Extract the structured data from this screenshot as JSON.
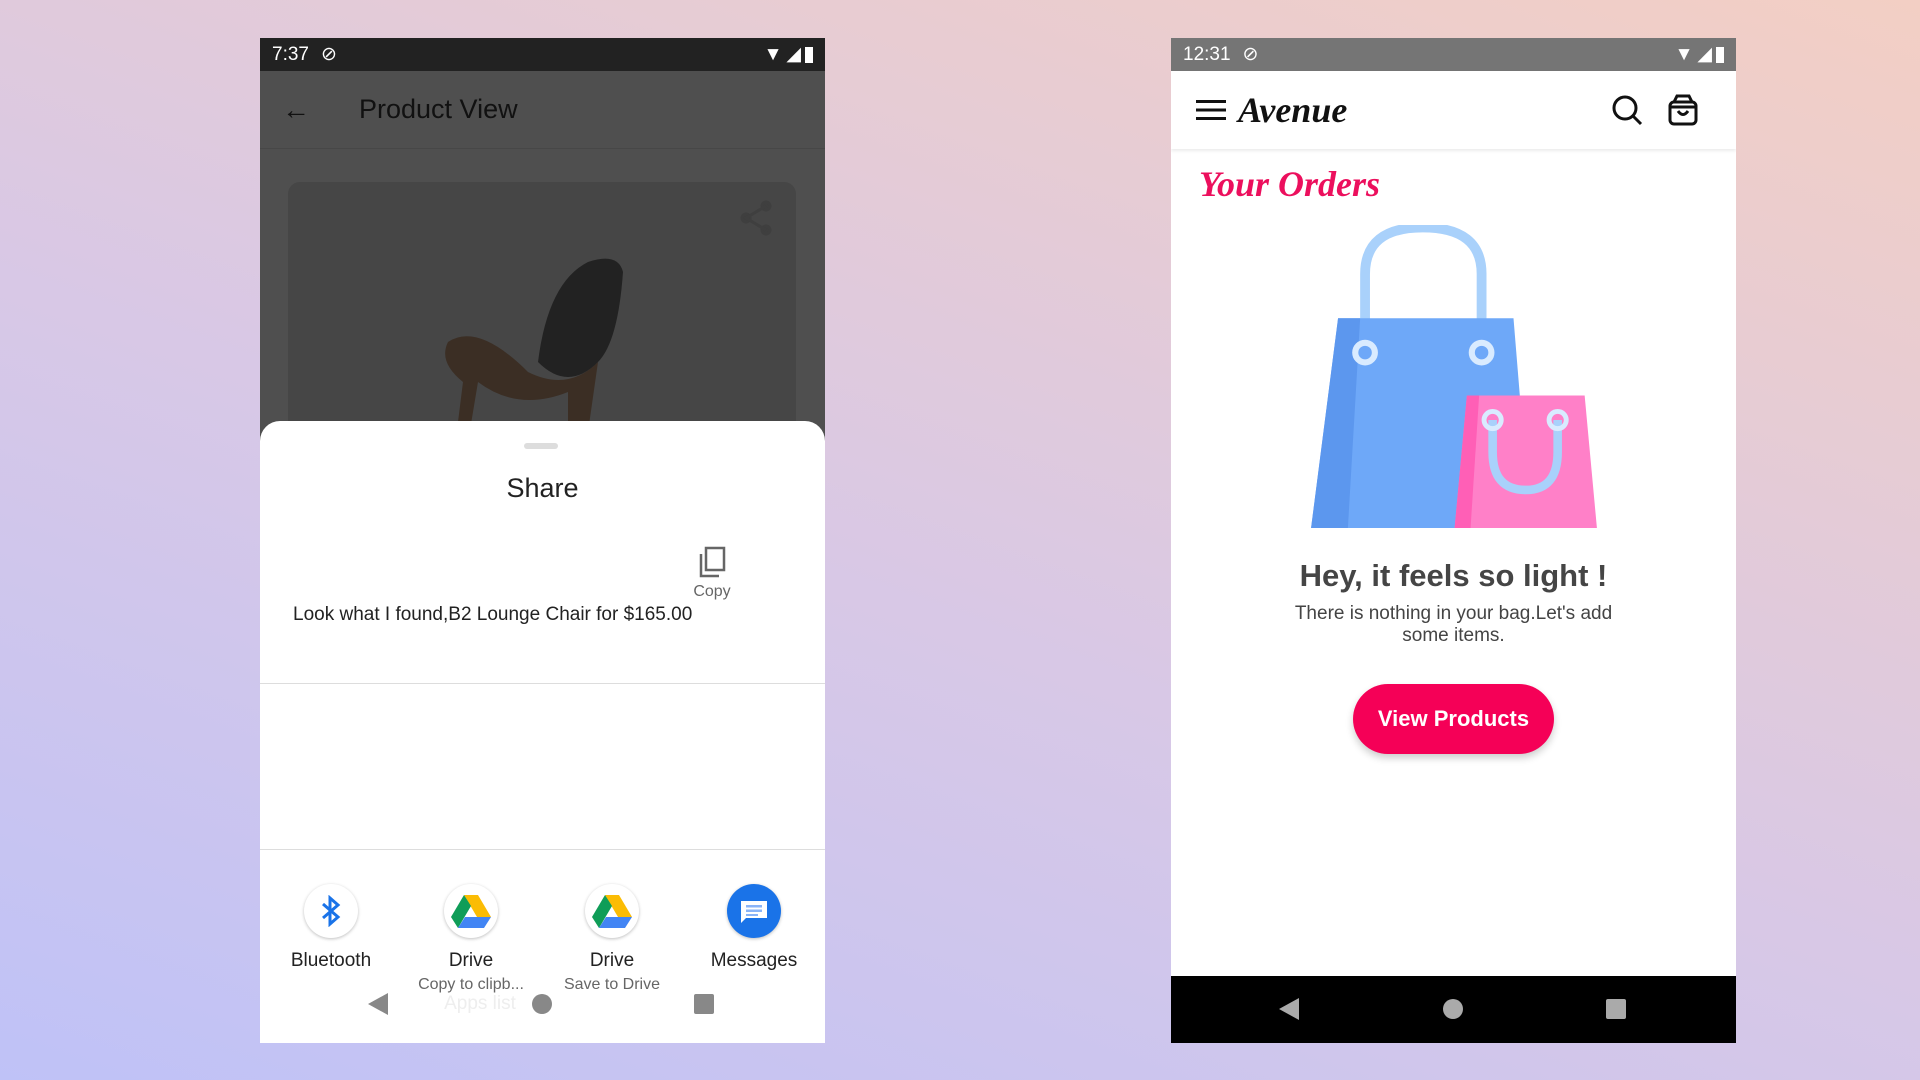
{
  "left_phone": {
    "status": {
      "time": "7:37"
    },
    "appbar": {
      "title": "Product View"
    },
    "share_sheet": {
      "title": "Share",
      "message": "Look what I found,B2 Lounge Chair for $165.00",
      "copy_label": "Copy",
      "targets": [
        {
          "label": "Bluetooth",
          "sub": "",
          "icon": "bluetooth-icon"
        },
        {
          "label": "Drive",
          "sub": "Copy to clipb...",
          "icon": "google-drive-icon"
        },
        {
          "label": "Drive",
          "sub": "Save to Drive",
          "icon": "google-drive-icon"
        },
        {
          "label": "Messages",
          "sub": "",
          "icon": "messages-icon"
        }
      ],
      "faded_label": "Apps list"
    }
  },
  "right_phone": {
    "status": {
      "time": "12:31"
    },
    "header": {
      "logo": "Avenue"
    },
    "page_title": "Your Orders",
    "empty": {
      "heading": "Hey, it feels so light !",
      "text": "There is nothing in your bag.Let's add some items.",
      "button": "View Products"
    },
    "colors": {
      "accent": "#f50057",
      "title": "#ec0f5d"
    }
  }
}
